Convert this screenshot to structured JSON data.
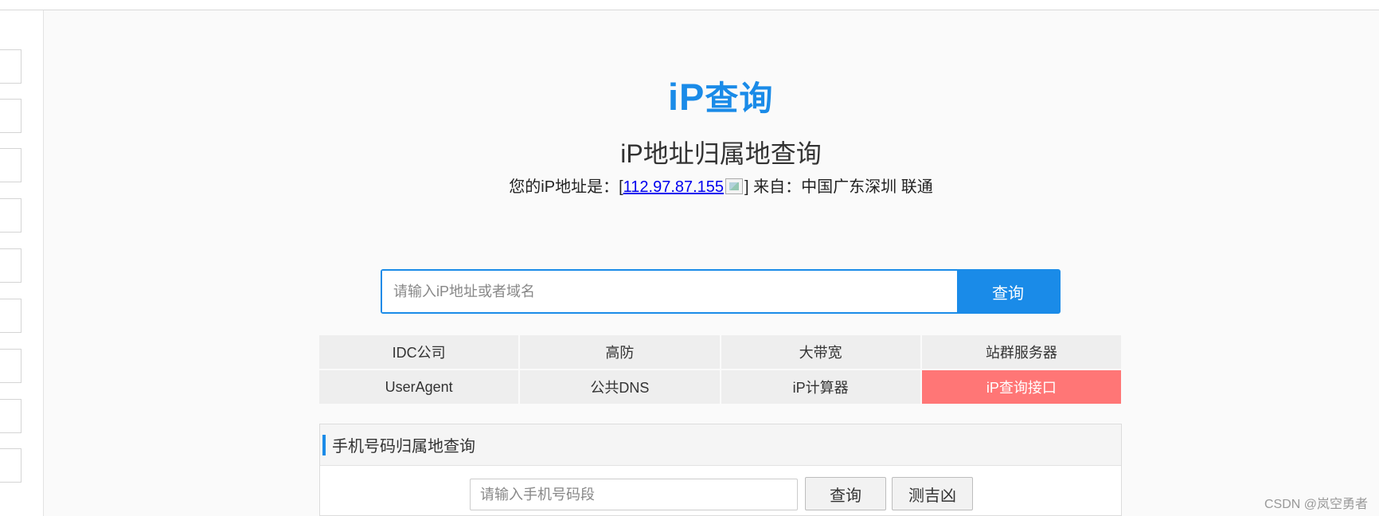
{
  "logo": {
    "latin": "iP",
    "cn": "查询"
  },
  "page_title": "iP地址归属地查询",
  "ip_info": {
    "prefix": "您的iP地址是：[",
    "ip": "112.97.87.155",
    "suffix": "] 来自：中国广东深圳 联通"
  },
  "search": {
    "placeholder": "请输入iP地址或者域名",
    "button_label": "查询"
  },
  "quick_links": [
    {
      "label": "IDC公司"
    },
    {
      "label": "高防"
    },
    {
      "label": "大带宽"
    },
    {
      "label": "站群服务器"
    },
    {
      "label": "UserAgent"
    },
    {
      "label": "公共DNS"
    },
    {
      "label": "iP计算器"
    },
    {
      "label": "iP查询接口"
    }
  ],
  "phone_panel": {
    "title": "手机号码归属地查询",
    "placeholder": "请输入手机号码段",
    "query_label": "查询",
    "luck_label": "测吉凶"
  },
  "watermark": "CSDN @岚空勇者",
  "colors": {
    "accent": "#1a8be8",
    "highlight": "#ff7676"
  }
}
